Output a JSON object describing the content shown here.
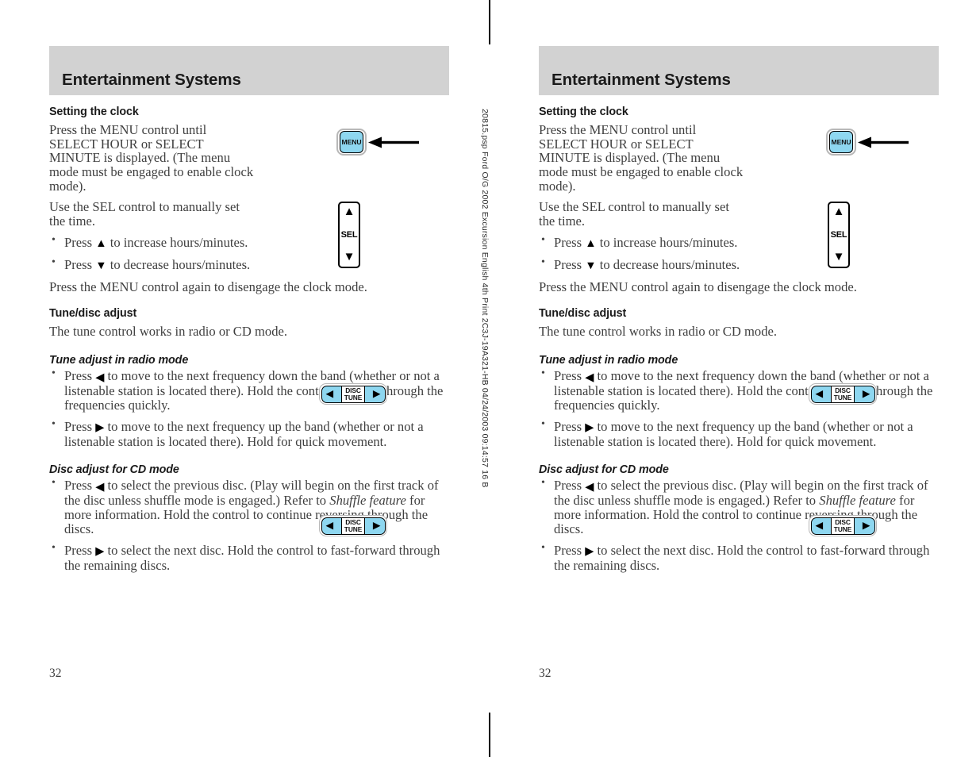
{
  "spine": {
    "marker_text": "20815.psp Ford O/G 2002 Excursion English 4th Print 2C3J-19A321-HB 04/24/2003 09:14:57 16 B"
  },
  "page": {
    "header_title": "Entertainment Systems",
    "page_number": "32",
    "sections": {
      "clock": {
        "heading": "Setting the clock",
        "para1": "Press the MENU control until SELECT HOUR or SELECT MINUTE is displayed. (The menu mode must be engaged to enable clock mode).",
        "para2": "Use the SEL control to manually set the time.",
        "bullet1_a": "Press",
        "bullet1_tri": "▲",
        "bullet1_b": "to increase hours/minutes.",
        "bullet2_a": "Press",
        "bullet2_tri": "▼",
        "bullet2_b": "to decrease hours/minutes.",
        "para3": "Press the MENU control again to disengage the clock mode."
      },
      "tune_disc": {
        "heading": "Tune/disc adjust",
        "para1": "The tune control works in radio or CD mode."
      },
      "tune_radio": {
        "heading": "Tune adjust in radio mode",
        "bullet1_a": "Press",
        "bullet1_tri": "◀",
        "bullet1_b": "to move to the next frequency down the band (whether or not a listenable station is located there). Hold the control to move through the frequencies quickly.",
        "bullet2_a": "Press",
        "bullet2_tri": "▶",
        "bullet2_b": "to move to the next frequency up the band (whether or not a listenable station is located there). Hold for quick movement."
      },
      "disc_cd": {
        "heading": "Disc adjust for CD mode",
        "bullet1_a": "Press",
        "bullet1_tri": "◀",
        "bullet1_b": "to select the previous disc. (Play will begin on the first track of the disc unless shuffle mode is engaged.) Refer to",
        "bullet1_italic": "Shuffle feature",
        "bullet1_c": "for more information. Hold the control to continue reversing through the discs.",
        "bullet2_a": "Press",
        "bullet2_tri": "▶",
        "bullet2_b": "to select the next disc. Hold the control to fast-forward through the remaining discs."
      }
    },
    "controls": {
      "menu_button_label": "MENU",
      "sel_up_glyph": "▲",
      "sel_label": "SEL",
      "sel_down_glyph": "▼",
      "disc_left_glyph": "◀",
      "disc_right_glyph": "▶",
      "disc_label_line1": "DISC",
      "disc_label_line2": "TUNE"
    }
  },
  "colors": {
    "header_bar": "#d2d2d2",
    "button_blue": "#8ed7f0",
    "outline": "#000000",
    "body_text": "#3f3f3f"
  }
}
